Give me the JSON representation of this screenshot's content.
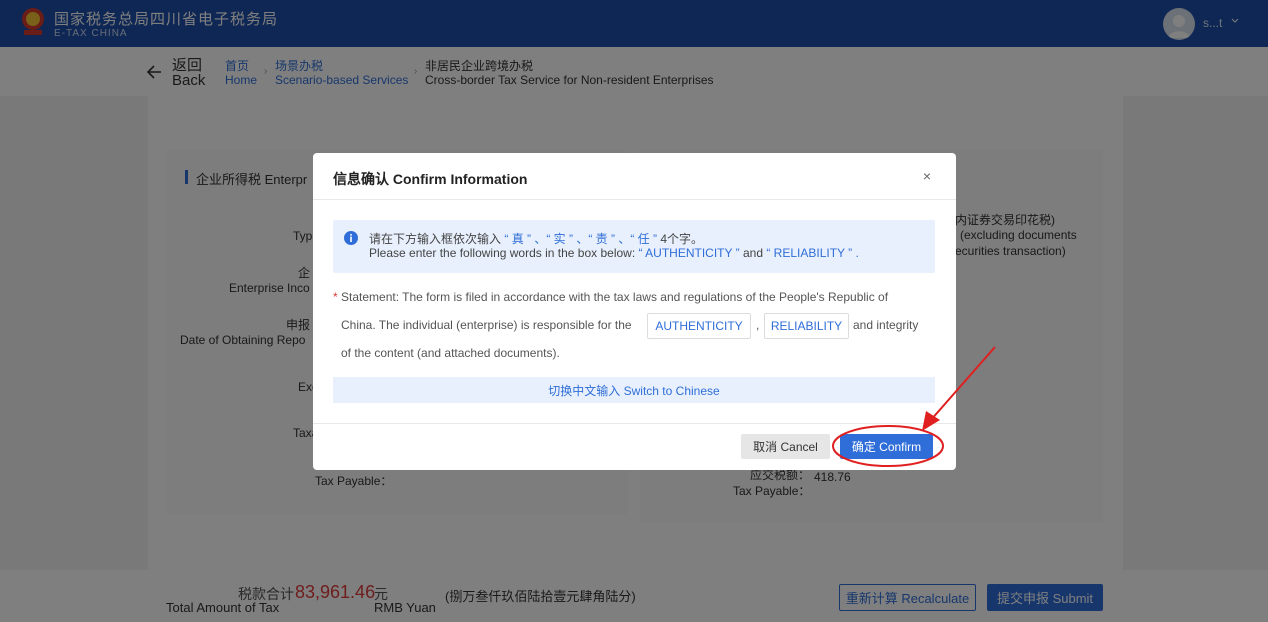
{
  "header": {
    "brand_cn": "国家税务总局四川省电子税务局",
    "brand_en": "E-TAX  CHINA",
    "user_name": "s...t"
  },
  "breadcrumb": {
    "back_cn": "返回",
    "back_en": "Back",
    "items": [
      {
        "cn": "首页",
        "en": "Home"
      },
      {
        "cn": "场景办税",
        "en": "Scenario-based Services"
      },
      {
        "cn": "非居民企业跨境办税",
        "en": "Cross-border Tax Service for Non-resident Enterprises"
      }
    ]
  },
  "background": {
    "section_title": "企业所得税 Enterpr",
    "left_labels": [
      "Typ",
      "企",
      "Enterprise Inco",
      "申报",
      "Date of Obtaining Repo",
      "Exc",
      "Taxa",
      "Tax Payable："
    ],
    "right_lines": [
      "内证券交易印花税)",
      "(excluding documents",
      "ecurities transaction)"
    ],
    "right_value_label_cn": "应交税额：",
    "right_value_label_en": "Tax Payable：",
    "right_value": "418.76"
  },
  "footer": {
    "total_cn": "税款合计",
    "total_en": "Total Amount of Tax",
    "amount": "83,961.46",
    "unit_cn": "元",
    "unit_en": "RMB Yuan",
    "amount_words": "(捌万叁仟玖佰陆拾壹元肆角陆分)",
    "recalc_label": "重新计算 Recalculate",
    "submit_label": "提交申报 Submit"
  },
  "modal": {
    "title": "信息确认 Confirm Information",
    "close": "×",
    "tip_cn_pre": "请在下方输入框依次输入",
    "tip_cn_words": "“ 真 ” 、“ 实 ” 、“ 责 ” 、“ 任 ”",
    "tip_cn_post": "4个字。",
    "tip_en_pre": "Please enter the following words in the box below:",
    "tip_en_w1": "“ AUTHENTICITY ”",
    "tip_en_and": "and",
    "tip_en_w2": "“ RELIABILITY ”",
    "tip_en_end": ".",
    "stmt_req": "*",
    "stmt_line1": "Statement: The form is filed in accordance with the tax laws and regulations of the People's Republic of",
    "stmt_line2_pre": "China. The individual (enterprise) is responsible for the",
    "box1": "AUTHENTICITY",
    "comma": ",",
    "box2": "RELIABILITY",
    "stmt_line2_post": "and integrity",
    "stmt_line3": "of the content (and attached documents).",
    "switch_label": "切换中文输入 Switch to Chinese",
    "cancel_label": "取消 Cancel",
    "confirm_label": "确定 Confirm"
  },
  "colors": {
    "header_bg": "#1f4fa8",
    "accent": "#2f6ed8",
    "amount": "#e03a3a",
    "annotation": "#e02020"
  }
}
